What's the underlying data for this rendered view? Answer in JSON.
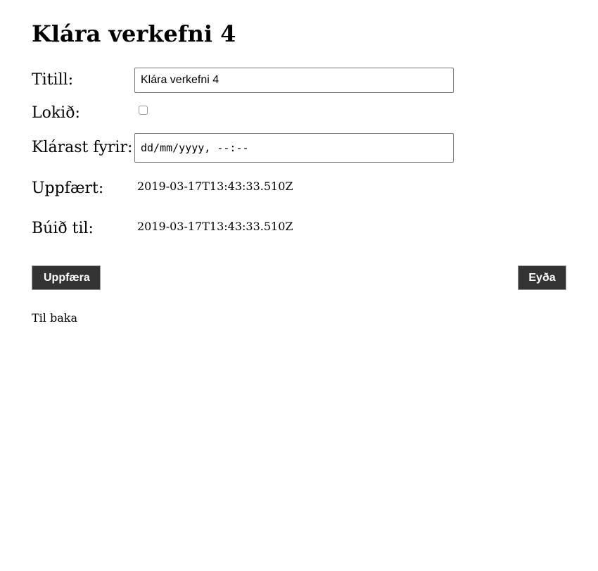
{
  "page_title": "Klára verkefni 4",
  "form": {
    "title_label": "Titill:",
    "title_value": "Klára verkefni 4",
    "completed_label": "Lokið:",
    "completed_checked": false,
    "due_label": "Klárast fyrir:",
    "due_placeholder": "dd/mm/yyyy, --:--",
    "updated_label": "Uppfært:",
    "updated_value": "2019-03-17T13:43:33.510Z",
    "created_label": "Búið til:",
    "created_value": "2019-03-17T13:43:33.510Z"
  },
  "actions": {
    "update_label": "Uppfæra",
    "delete_label": "Eyða"
  },
  "back_link": "Til baka",
  "colors": {
    "button_bg": "#333333",
    "button_text": "#ffffff"
  }
}
